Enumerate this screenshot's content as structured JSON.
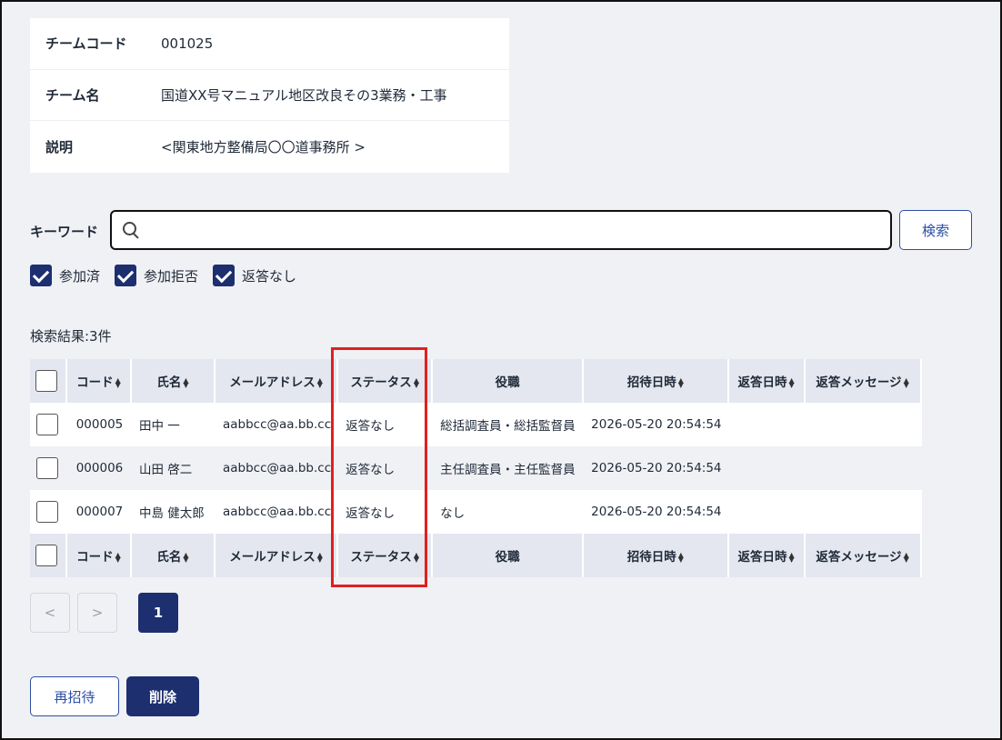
{
  "team_info": {
    "rows": [
      {
        "label": "チームコード",
        "value": "001025"
      },
      {
        "label": "チーム名",
        "value": "国道XX号マニュアル地区改良その3業務・工事"
      },
      {
        "label": "説明",
        "value": "<関東地方整備局〇〇道事務所 >"
      }
    ]
  },
  "search": {
    "keyword_label": "キーワード",
    "value": "",
    "button_label": "検索"
  },
  "filters": [
    {
      "label": "参加済",
      "checked": true
    },
    {
      "label": "参加拒否",
      "checked": true
    },
    {
      "label": "返答なし",
      "checked": true
    }
  ],
  "result_count": "検索結果:3件",
  "table": {
    "headers": {
      "code": "コード",
      "name": "氏名",
      "mail": "メールアドレス",
      "status": "ステータス",
      "role": "役職",
      "invited": "招待日時",
      "answered": "返答日時",
      "message": "返答メッセージ"
    },
    "rows": [
      {
        "code": "000005",
        "name": "田中 一",
        "mail": "aabbcc@aa.bb.cc",
        "status": "返答なし",
        "role": "総括調査員・総括監督員",
        "invited": "2026-05-20 20:54:54",
        "answered": "",
        "message": ""
      },
      {
        "code": "000006",
        "name": "山田 啓二",
        "mail": "aabbcc@aa.bb.cc",
        "status": "返答なし",
        "role": "主任調査員・主任監督員",
        "invited": "2026-05-20 20:54:54",
        "answered": "",
        "message": ""
      },
      {
        "code": "000007",
        "name": "中島 健太郎",
        "mail": "aabbcc@aa.bb.cc",
        "status": "返答なし",
        "role": "なし",
        "invited": "2026-05-20 20:54:54",
        "answered": "",
        "message": ""
      }
    ]
  },
  "pagination": {
    "prev": "<",
    "next": ">",
    "current": "1"
  },
  "actions": {
    "reinvite": "再招待",
    "delete": "削除"
  },
  "icons": {
    "search": "search-icon",
    "sort": "sort-icon"
  },
  "colors": {
    "primary": "#1d2f6f",
    "accent_outline": "#2d4ea3",
    "highlight": "#e0201f",
    "background": "#f0f1f5"
  }
}
